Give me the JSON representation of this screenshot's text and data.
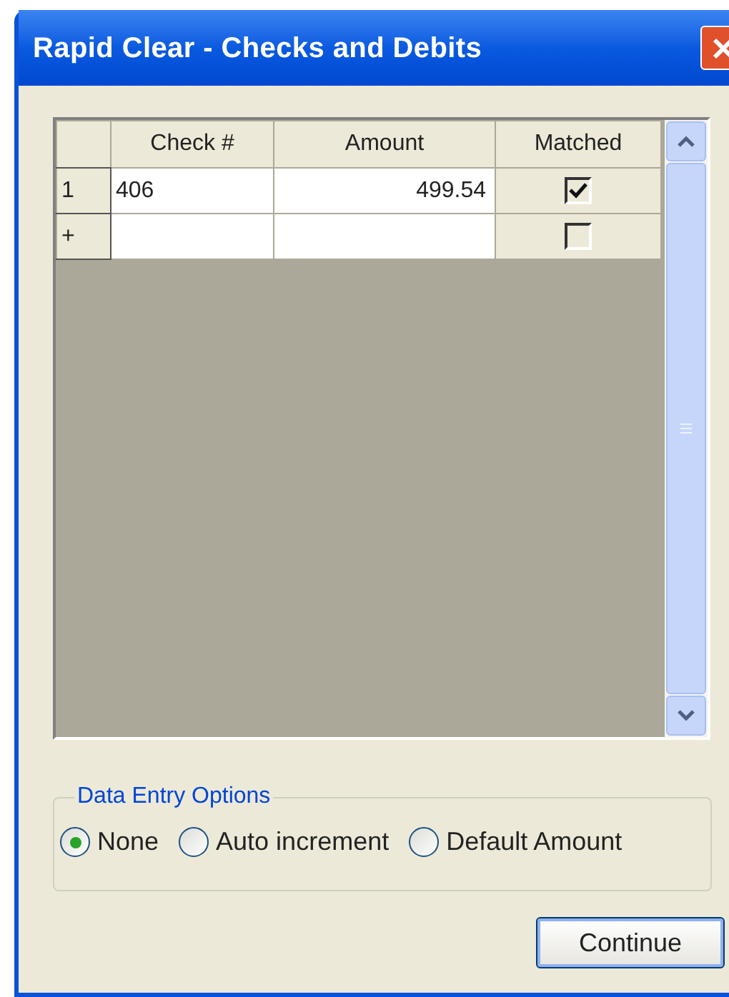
{
  "window": {
    "title": "Rapid Clear - Checks and Debits"
  },
  "table": {
    "columns": [
      "Check #",
      "Amount",
      "Matched"
    ],
    "rows": [
      {
        "header": "1",
        "check": "406",
        "amount": "499.54",
        "matched": true
      },
      {
        "header": "+",
        "check": "",
        "amount": "",
        "matched": false
      }
    ]
  },
  "options": {
    "title": "Data Entry Options",
    "radios": [
      {
        "label": "None",
        "selected": true
      },
      {
        "label": "Auto increment",
        "selected": false
      },
      {
        "label": "Default Amount",
        "selected": false
      }
    ]
  },
  "buttons": [
    "Continue"
  ]
}
